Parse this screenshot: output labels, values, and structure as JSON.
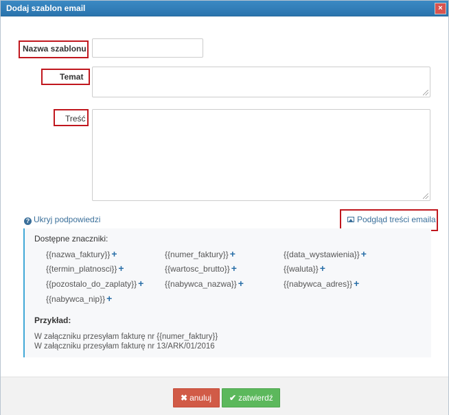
{
  "dialog": {
    "title": "Dodaj szablon email",
    "close_glyph": "×"
  },
  "form": {
    "name_label": "Nazwa szablonu",
    "name_value": "",
    "subject_label": "Temat",
    "subject_value": "",
    "body_label": "Treść",
    "body_value": ""
  },
  "hints": {
    "toggle_label": "Ukryj podpowiedzi",
    "preview_label": "Podgląd treści emaila",
    "available_heading": "Dostępne znaczniki:",
    "tags": [
      "{{nazwa_faktury}}",
      "{{numer_faktury}}",
      "{{data_wystawienia}}",
      "{{termin_platnosci}}",
      "{{wartosc_brutto}}",
      "{{waluta}}",
      "{{pozostalo_do_zaplaty}}",
      "{{nabywca_nazwa}}",
      "{{nabywca_adres}}",
      "{{nabywca_nip}}"
    ],
    "example_label": "Przykład:",
    "example_lines": [
      "W załączniku przesyłam fakturę nr {{numer_faktury}}",
      "W załączniku przesyłam fakturę nr 13/ARK/01/2016"
    ]
  },
  "footer": {
    "cancel_label": "anuluj",
    "ok_label": "zatwierdź"
  },
  "colors": {
    "titlebar": "#2f7fba",
    "highlight_box": "#c0161d",
    "cancel_button": "#d15b47",
    "ok_button": "#5cb85c",
    "link": "#3a6f9a"
  }
}
